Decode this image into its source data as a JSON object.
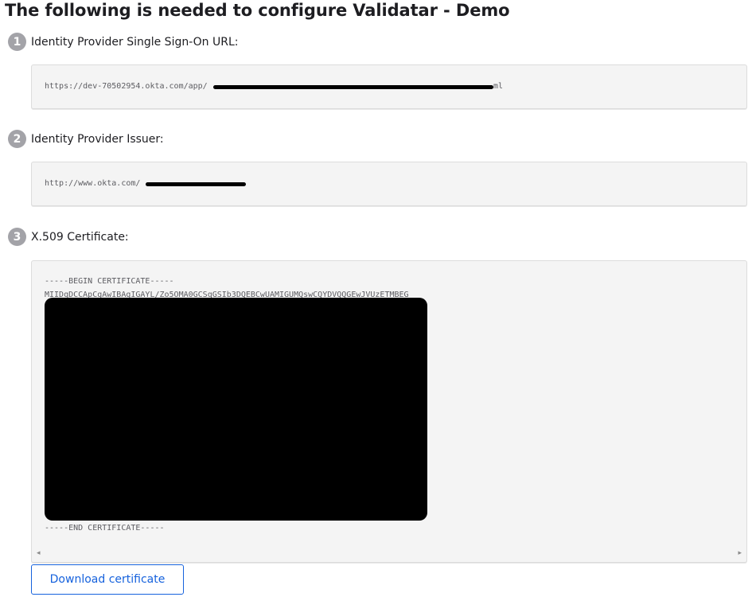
{
  "title": "The following is needed to configure Validatar - Demo",
  "steps": [
    {
      "number": "1",
      "label": "Identity Provider Single Sign-On URL:",
      "value_prefix": "https://dev-70502954.okta.com/app/",
      "value_suffix": "ml"
    },
    {
      "number": "2",
      "label": "Identity Provider Issuer:",
      "value_prefix": "http://www.okta.com/",
      "value_suffix": ""
    },
    {
      "number": "3",
      "label": "X.509 Certificate:",
      "cert_begin": "-----BEGIN CERTIFICATE-----",
      "cert_first_line": "MIIDqDCCApCgAwIBAgIGAYL/Zo5OMA0GCSqGSIb3DQEBCwUAMIGUMQswCQYDVQQGEwJVUzETMBEG",
      "cert_end": "-----END CERTIFICATE-----"
    }
  ],
  "scroll": {
    "left_arrow": "◂",
    "right_arrow": "▸"
  },
  "download_button": {
    "label": "Download certificate"
  },
  "colors": {
    "accent": "#1662dd",
    "step_badge": "#a3a3a8",
    "code_box_bg": "#f4f4f4",
    "redaction": "#000000"
  }
}
